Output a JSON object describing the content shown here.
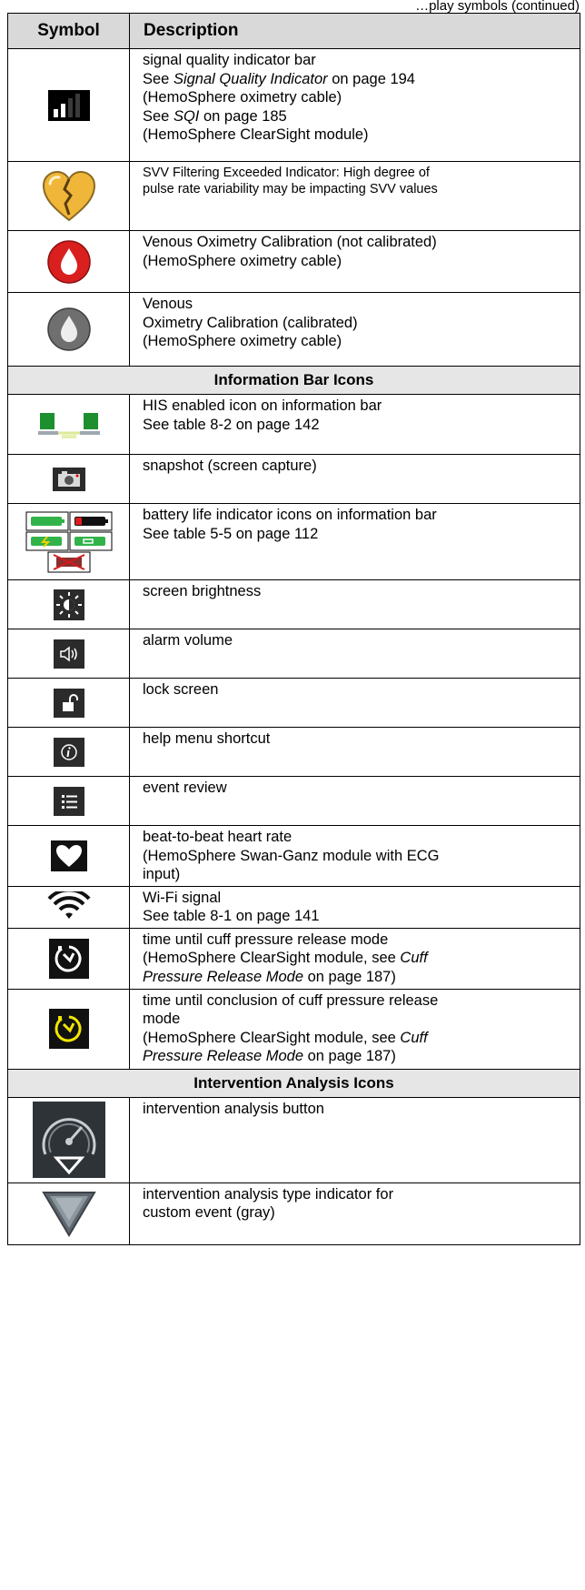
{
  "header_fragment": "…play symbols (continued)",
  "table": {
    "col_symbol": "Symbol",
    "col_description": "Description"
  },
  "rows": {
    "signal_quality": {
      "l1": "signal quality indicator bar",
      "l2a": "See ",
      "l2b": "Signal Quality Indicator",
      "l2c": " on page 194",
      "l3": "(HemoSphere oximetry cable)",
      "l4a": "See ",
      "l4b": "SQI",
      "l4c": " on page 185",
      "l5": "(HemoSphere ClearSight module)"
    },
    "svv_filter": {
      "l1": "SVV Filtering Exceeded Indicator: High degree of",
      "l2": "pulse rate variability may be impacting SVV values"
    },
    "venous_not_cal": {
      "l1": "Venous Oximetry Calibration (not calibrated)",
      "l2": "(HemoSphere oximetry cable)"
    },
    "venous_cal": {
      "l1": "Venous",
      "l2": "Oximetry Calibration (calibrated)",
      "l3": "(HemoSphere oximetry cable)"
    },
    "section_info": "Information Bar Icons",
    "his": {
      "l1": "HIS enabled icon on information bar",
      "l2": "See table 8-2 on page 142"
    },
    "snapshot": {
      "l1": "snapshot (screen capture)"
    },
    "battery": {
      "l1": "battery life indicator icons on information bar",
      "l2": "See table 5-5 on page 112"
    },
    "brightness": {
      "l1": "screen brightness"
    },
    "alarm_volume": {
      "l1": "alarm volume"
    },
    "lock": {
      "l1": "lock screen"
    },
    "help": {
      "l1": "help menu shortcut"
    },
    "event_review": {
      "l1": "event review"
    },
    "heart_rate": {
      "l1": "beat-to-beat heart rate",
      "l2": "(HemoSphere Swan-Ganz module with ECG",
      "l3": "input)"
    },
    "wifi": {
      "l1": "Wi-Fi signal",
      "l2": "See table 8-1 on page 141"
    },
    "cuff_release": {
      "l1": "time until cuff pressure release mode",
      "l2a": "(HemoSphere ClearSight module, see ",
      "l2b": "Cuff",
      "l3a": "Pressure Release Mode",
      "l3b": " on page 187)"
    },
    "cuff_conclusion": {
      "l1": "time until conclusion of cuff pressure release",
      "l2": "mode",
      "l3a": "(HemoSphere ClearSight module, see ",
      "l3b": "Cuff",
      "l4a": "Pressure Release Mode",
      "l4b": " on page 187)"
    },
    "section_intervention": "Intervention Analysis Icons",
    "intervention_button": {
      "l1": "intervention analysis button"
    },
    "intervention_type": {
      "l1": "intervention analysis type indicator for",
      "l2": "custom event (gray)"
    }
  },
  "icons": {
    "signal_quality": "signal-bars-icon",
    "svv_filter": "broken-heart-icon",
    "venous_not_cal": "red-droplet-icon",
    "venous_cal": "gray-droplet-icon",
    "his": "networked-computers-icon",
    "snapshot": "camera-icon",
    "battery": "battery-icons",
    "brightness": "brightness-icon",
    "alarm_volume": "speaker-icon",
    "lock": "padlock-icon",
    "help": "info-icon",
    "event_review": "list-icon",
    "heart_rate": "heart-icon",
    "wifi": "wifi-icon",
    "cuff_release": "timer-icon",
    "cuff_conclusion": "yellow-timer-icon",
    "intervention_button": "gauge-icon",
    "intervention_type": "gray-triangle-icon"
  },
  "colors": {
    "header_bg": "#d9d9d9",
    "section_bg": "#e6e6e6",
    "red_drop": "#d9201f",
    "yellow_timer": "#f2e600",
    "heart_gold": "#f0b63a"
  }
}
